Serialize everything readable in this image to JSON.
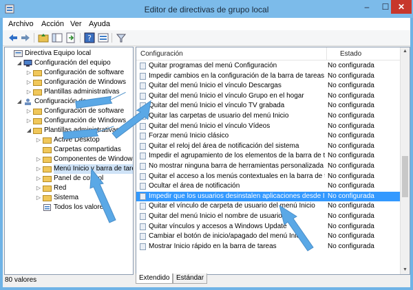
{
  "window": {
    "title": "Editor de directivas de grupo local",
    "min": "–",
    "max": "☐",
    "close": "✕"
  },
  "menu": [
    "Archivo",
    "Acción",
    "Ver",
    "Ayuda"
  ],
  "toolbar": [
    "back-icon",
    "forward-icon",
    "up-folder-icon",
    "show-hide-tree-icon",
    "export-list-icon",
    "help-icon",
    "properties-icon",
    "filter-icon"
  ],
  "tree": [
    {
      "label": "Directiva Equipo local",
      "exp": "",
      "icon": "computer-policy-icon"
    },
    {
      "label": "Configuración del equipo",
      "exp": "◢",
      "icon": "computer-icon"
    },
    {
      "label": "Configuración de software",
      "exp": "▷",
      "icon": "folder-icon"
    },
    {
      "label": "Configuración de Windows",
      "exp": "▷",
      "icon": "folder-icon"
    },
    {
      "label": "Plantillas administrativas",
      "exp": "▷",
      "icon": "folder-icon"
    },
    {
      "label": "Configuración de usuario",
      "exp": "◢",
      "icon": "user-icon"
    },
    {
      "label": "Configuración de software",
      "exp": "▷",
      "icon": "folder-icon"
    },
    {
      "label": "Configuración de Windows",
      "exp": "▷",
      "icon": "folder-icon"
    },
    {
      "label": "Plantillas administrativas",
      "exp": "◢",
      "icon": "folder-icon"
    },
    {
      "label": "Active Desktop",
      "exp": "▷",
      "icon": "folder-icon"
    },
    {
      "label": "Carpetas compartidas",
      "exp": "",
      "icon": "folder-icon"
    },
    {
      "label": "Componentes de Windows",
      "exp": "▷",
      "icon": "folder-icon"
    },
    {
      "label": "Menú Inicio y barra de tareas",
      "exp": "▷",
      "icon": "folder-icon",
      "selected": true
    },
    {
      "label": "Panel de control",
      "exp": "▷",
      "icon": "folder-icon"
    },
    {
      "label": "Red",
      "exp": "▷",
      "icon": "folder-icon"
    },
    {
      "label": "Sistema",
      "exp": "▷",
      "icon": "folder-icon"
    },
    {
      "label": "Todos los valores",
      "exp": "",
      "icon": "all-settings-icon"
    }
  ],
  "list": {
    "col1": "Configuración",
    "col2": "Estado",
    "rows": [
      {
        "name": "Quitar programas del menú Configuración",
        "state": "No configurada"
      },
      {
        "name": "Impedir cambios en la configuración de la barra de tareas y ...",
        "state": "No configurada"
      },
      {
        "name": "Quitar del menú Inicio el vínculo Descargas",
        "state": "No configurada"
      },
      {
        "name": "Quitar del menú Inicio el vínculo Grupo en el hogar",
        "state": "No configurada"
      },
      {
        "name": "Quitar del menú Inicio el vínculo TV grabada",
        "state": "No configurada"
      },
      {
        "name": "Quitar las carpetas de usuario del menú Inicio",
        "state": "No configurada"
      },
      {
        "name": "Quitar del menú Inicio el vínculo Vídeos",
        "state": "No configurada"
      },
      {
        "name": "Forzar menú Inicio clásico",
        "state": "No configurada"
      },
      {
        "name": "Quitar el reloj del área de notificación del sistema",
        "state": "No configurada"
      },
      {
        "name": "Impedir el agrupamiento de los elementos de la barra de tar...",
        "state": "No configurada"
      },
      {
        "name": "No mostrar ninguna barra de herramientas personalizada en...",
        "state": "No configurada"
      },
      {
        "name": "Quitar el acceso a los menús contextuales en la barra de tar...",
        "state": "No configurada"
      },
      {
        "name": "Ocultar el área de notificación",
        "state": "No configurada"
      },
      {
        "name": "Impedir que los usuarios desinstalen aplicaciones desde Inicio",
        "state": "No configurada",
        "selected": true
      },
      {
        "name": "Quitar el vínculo de carpeta de usuario del menú Inicio",
        "state": "No configurada"
      },
      {
        "name": "Quitar del menú Inicio el nombre de usuario",
        "state": "No configurada"
      },
      {
        "name": "Quitar vínculos y accesos a Windows Update",
        "state": "No configurada"
      },
      {
        "name": "Cambiar el botón de inicio/apagado del menú Inicio",
        "state": "No configurada"
      },
      {
        "name": "Mostrar Inicio rápido en la barra de tareas",
        "state": "No configurada"
      }
    ]
  },
  "tabs": [
    "Extendido",
    "Estándar"
  ],
  "status": "80 valores",
  "colors": {
    "accent": "#3399ff",
    "arrow": "#5aa8e6"
  }
}
